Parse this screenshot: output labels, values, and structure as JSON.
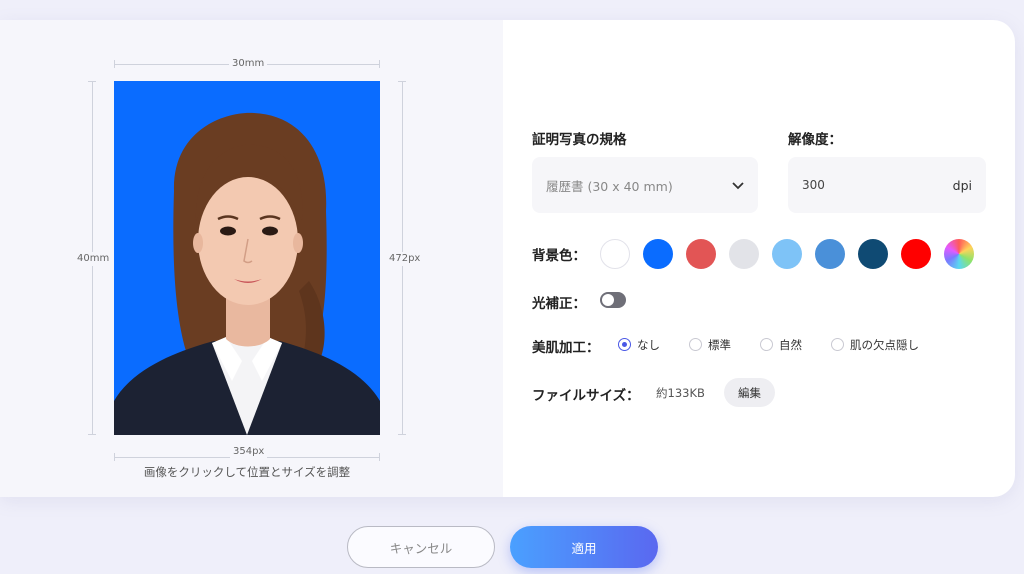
{
  "preview": {
    "width_mm": "30mm",
    "height_mm": "40mm",
    "width_px": "354px",
    "height_px": "472px",
    "hint": "画像をクリックして位置とサイズを調整",
    "background_color": "#0a6cff"
  },
  "settings": {
    "spec_label": "証明写真の規格",
    "spec_value": "履歴書 (30 x 40 mm)",
    "resolution_label": "解像度：",
    "resolution_value": "300",
    "resolution_unit": "dpi",
    "background_label": "背景色：",
    "background_colors": [
      "#ffffff",
      "#0a6cff",
      "#e25555",
      "#e2e3e8",
      "#7ec3f7",
      "#4a90d9",
      "#0f4a73",
      "#ff0000",
      "rainbow"
    ],
    "selected_background": "#0a6cff",
    "light_correction_label": "光補正：",
    "light_correction_on": false,
    "beauty_label": "美肌加工：",
    "beauty_options": [
      "なし",
      "標準",
      "自然",
      "肌の欠点隠し"
    ],
    "beauty_selected": "なし",
    "filesize_label": "ファイルサイズ：",
    "filesize_value": "約133KB",
    "edit_label": "編集"
  },
  "actions": {
    "cancel_label": "キャンセル",
    "apply_label": "適用"
  }
}
